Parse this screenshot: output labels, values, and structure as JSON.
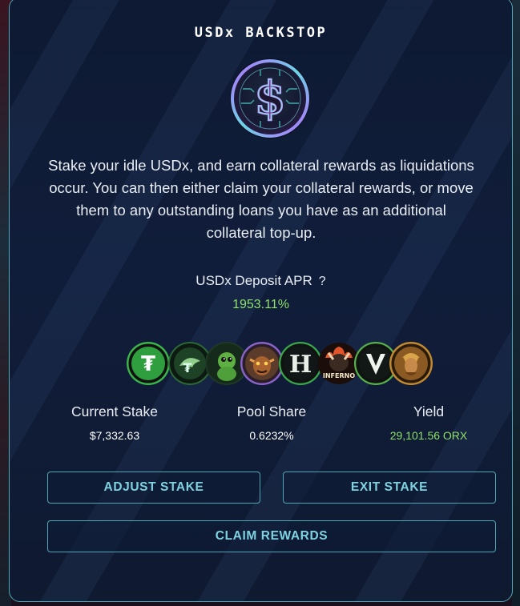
{
  "header": {
    "title": "USDx BACKSTOP"
  },
  "description": "Stake your idle USDx, and earn collateral rewards as liquidations occur. You can then either claim your collateral rewards, or move them to any outstanding loans you have as an additional collateral top-up.",
  "apr": {
    "label": "USDx Deposit APR",
    "help": "?",
    "value": "1953.11%"
  },
  "tokens": [
    {
      "icon": "tf-token-icon",
      "color": "#3ab54a"
    },
    {
      "icon": "dragon-token-icon",
      "color": "#2d6b36"
    },
    {
      "icon": "baby-dragon-token-icon",
      "color": "#4f9f3b"
    },
    {
      "icon": "monster-token-icon",
      "color": "#b9733a"
    },
    {
      "icon": "h-token-icon",
      "color": "#3aa74a"
    },
    {
      "icon": "inferno-token-icon",
      "color": "#c8452a"
    },
    {
      "icon": "v-token-icon",
      "color": "#57b04a"
    },
    {
      "icon": "warrior-token-icon",
      "color": "#c28a2e"
    }
  ],
  "stats": {
    "current_stake": {
      "label": "Current Stake",
      "value": "$7,332.63"
    },
    "pool_share": {
      "label": "Pool Share",
      "value": "0.6232%"
    },
    "yield": {
      "label": "Yield",
      "value": "29,101.56 ORX"
    }
  },
  "buttons": {
    "adjust": "ADJUST STAKE",
    "exit": "EXIT STAKE",
    "claim": "CLAIM REWARDS"
  },
  "colors": {
    "accent": "#7fd3e1",
    "positive": "#8fe26a",
    "border": "#4fa7b5"
  }
}
